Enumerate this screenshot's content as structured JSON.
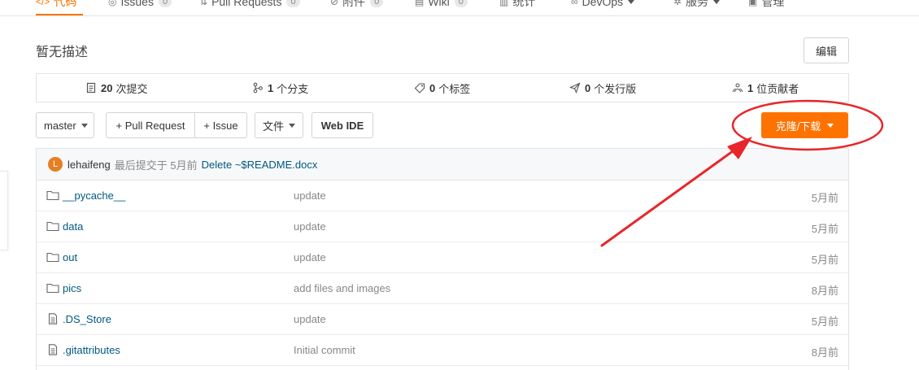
{
  "nav": {
    "tabs": [
      {
        "label": "代码",
        "icon": "code-icon",
        "count": ""
      },
      {
        "label": "Issues",
        "icon": "issues-icon",
        "count": "0"
      },
      {
        "label": "Pull Requests",
        "icon": "pull-request-icon",
        "count": "0"
      },
      {
        "label": "附件",
        "icon": "attachment-icon",
        "count": "0"
      },
      {
        "label": "Wiki",
        "icon": "wiki-icon",
        "count": "0"
      },
      {
        "label": "统计",
        "icon": "stats-icon",
        "count": ""
      },
      {
        "label": "DevOps",
        "icon": "devops-icon",
        "count": ""
      },
      {
        "label": "服务",
        "icon": "service-icon",
        "count": ""
      },
      {
        "label": "管理",
        "icon": "manage-icon",
        "count": ""
      }
    ]
  },
  "repo": {
    "description": "暂无描述",
    "edit_label": "编辑"
  },
  "stats": {
    "commits": {
      "count": "20",
      "label": "次提交"
    },
    "branches": {
      "count": "1",
      "label": "个分支"
    },
    "tags": {
      "count": "0",
      "label": "个标签"
    },
    "releases": {
      "count": "0",
      "label": "个发行版"
    },
    "contributors": {
      "count": "1",
      "label": "位贡献者"
    }
  },
  "toolbar": {
    "branch": "master",
    "pull_request": "+ Pull Request",
    "issue": "+ Issue",
    "file": "文件",
    "webide": "Web IDE",
    "clone": "克隆/下载"
  },
  "last_commit": {
    "avatar_letter": "L",
    "author": "lehaifeng",
    "meta": "最后提交于 5月前",
    "message": "Delete ~$README.docx"
  },
  "files": [
    {
      "type": "folder",
      "name": "__pycache__",
      "message": "update",
      "time": "5月前"
    },
    {
      "type": "folder",
      "name": "data",
      "message": "update",
      "time": "5月前"
    },
    {
      "type": "folder",
      "name": "out",
      "message": "update",
      "time": "5月前"
    },
    {
      "type": "folder",
      "name": "pics",
      "message": "add files and images",
      "time": "8月前"
    },
    {
      "type": "file",
      "name": ".DS_Store",
      "message": "update",
      "time": "5月前"
    },
    {
      "type": "file",
      "name": ".gitattributes",
      "message": "Initial commit",
      "time": "8月前"
    }
  ],
  "colors": {
    "accent": "#fe7300",
    "link": "#005980",
    "annotation": "#e8262b"
  }
}
